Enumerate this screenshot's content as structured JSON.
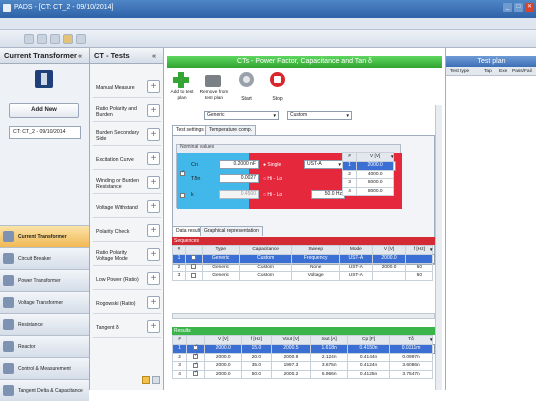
{
  "window": {
    "title": "PADS - [CT: CT_2 - 09/10/2014]"
  },
  "left_panel": {
    "title": "Current Transformer",
    "add_new": "Add New",
    "device_item": "CT: CT_2 - 09/10/2014",
    "nav": [
      {
        "label": "Current Transformer",
        "icon": "current-transformer-icon"
      },
      {
        "label": "Circuit Breaker",
        "icon": "circuit-breaker-icon"
      },
      {
        "label": "Power Transformer",
        "icon": "power-transformer-icon"
      },
      {
        "label": "Voltage Transformer",
        "icon": "voltage-transformer-icon"
      },
      {
        "label": "Resistance",
        "icon": "resistance-icon"
      },
      {
        "label": "Reactor",
        "icon": "reactor-icon"
      },
      {
        "label": "Control & Measurement",
        "icon": "control-measurement-icon"
      },
      {
        "label": "Tangent Delta & Capacitance",
        "icon": "tangent-delta-icon"
      }
    ]
  },
  "tests_panel": {
    "title": "CT - Tests",
    "items": [
      "Manual Measure",
      "Ratio Polarity and Burden",
      "Burden Secondary Side",
      "Excitation Curve",
      "Winding or Burden Resistance",
      "Voltage Withstand",
      "Polarity Check",
      "Ratio Polarity Voltage Mode",
      "Low Power (Ratio)",
      "Rogowski (Ratio)",
      "Tangent δ"
    ]
  },
  "main": {
    "title": "CTs - Power Factor, Capacitance and Tan δ",
    "toolbar": {
      "add_label": "Add to test plan",
      "remove_label": "Remove from test plan",
      "start_label": "Start",
      "stop_label": "Stop",
      "select1": "Generic",
      "select2": "Custom"
    },
    "tabs": [
      "Test settings",
      "Temperature comp."
    ],
    "nominal": {
      "title": "Nominal values",
      "cn_label": "Cn",
      "cn_value": "0.2000 nF",
      "tdn_label": "Tδn",
      "tdn_value": "0.0027",
      "k_label": "k",
      "k_value": "0.4500",
      "radio1": "Single",
      "radio2": "Hi - Lo",
      "radio3": "Hi - Lo",
      "mode_select": "UST-A",
      "freq_value": "50.0 Hz"
    },
    "voltage_table": {
      "headers": [
        "#",
        "V [V]"
      ],
      "rows": [
        [
          "1",
          "2000.0"
        ],
        [
          "2",
          "4000.0"
        ],
        [
          "3",
          "6000.0"
        ],
        [
          "4",
          "8000.0"
        ]
      ]
    },
    "result_tabs": [
      "Data results",
      "Graphical representation"
    ],
    "sequences": {
      "title": "Sequences",
      "headers": [
        "#",
        "",
        "Type",
        "Capacitance",
        "Sweep",
        "Mode",
        "V [V]",
        "f [Hz]"
      ],
      "rows": [
        [
          "1",
          "",
          "Generic",
          "Custom",
          "Frequency",
          "UST-A",
          "2000.0",
          ""
        ],
        [
          "2",
          "",
          "Generic",
          "Custom",
          "None",
          "UST-A",
          "2000.0",
          "50"
        ],
        [
          "3",
          "",
          "Generic",
          "Custom",
          "Voltage",
          "UST-A",
          "",
          "50"
        ]
      ]
    },
    "results": {
      "title": "Results",
      "headers": [
        "#",
        "",
        "V [V]",
        "f [Hz]",
        "Vout [V]",
        "Iout [A]",
        "Cp [F]",
        "Tδ"
      ],
      "rows": [
        [
          "1",
          "",
          "2000.0",
          "15.0",
          "2000.5",
          "1.618n",
          "0.4150n",
          "0.0111m"
        ],
        [
          "2",
          "",
          "2000.0",
          "20.0",
          "2000.9",
          "2.124n",
          "0.4144n",
          "0.0997n"
        ],
        [
          "3",
          "",
          "2000.0",
          "35.0",
          "1997.3",
          "3.675n",
          "0.4124n",
          "3.6086n"
        ],
        [
          "4",
          "",
          "2000.0",
          "50.0",
          "2000.2",
          "5.966n",
          "0.4125n",
          "3.7547n"
        ]
      ]
    }
  },
  "test_plan": {
    "title": "Test plan",
    "headers": [
      "Test type",
      "Tap",
      "Exe",
      "Pass/Fail"
    ]
  }
}
